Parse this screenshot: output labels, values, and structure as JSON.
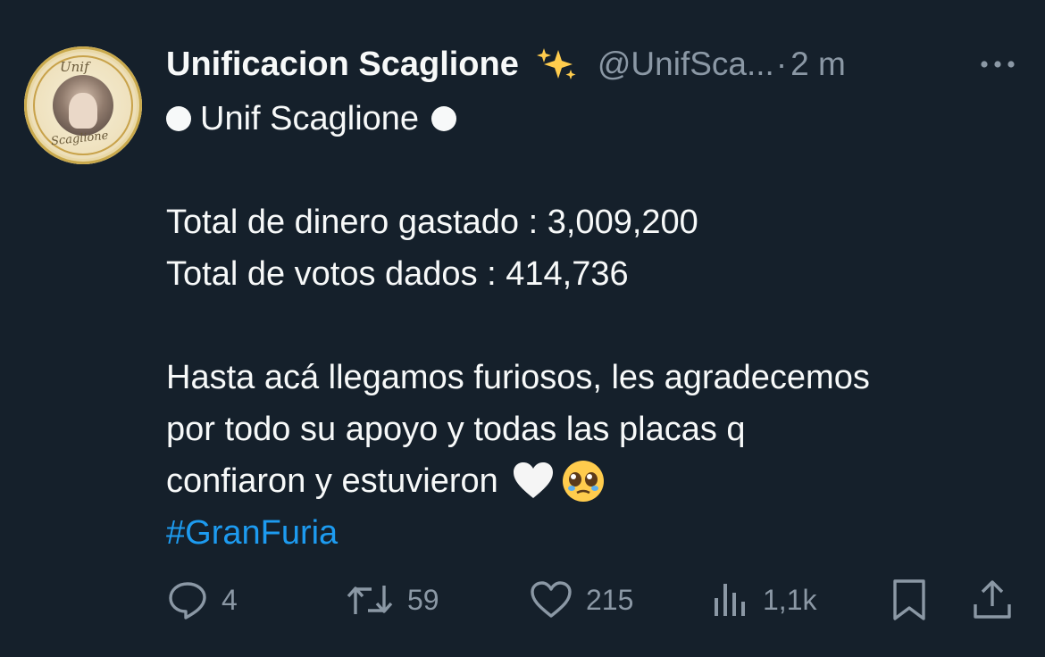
{
  "author": {
    "display_name": "Unificacion Scaglione",
    "name_emoji": "sparkles-icon",
    "handle": "@UnifSca...",
    "separator": "·",
    "time": "2 m",
    "avatar_text_top": "Unif",
    "avatar_text_bottom": "Scaglione"
  },
  "tweet": {
    "line1": "Unif Scaglione",
    "line2": "Total de dinero gastado : 3,009,200",
    "line3": "Total de votos dados : 414,736",
    "line4": "Hasta acá llegamos furiosos, les agradecemos",
    "line5": "por todo su apoyo y todas las placas q",
    "line6": "confiaron y estuvieron",
    "hashtag": "#GranFuria"
  },
  "actions": {
    "replies": "4",
    "retweets": "59",
    "likes": "215",
    "views": "1,1k"
  },
  "colors": {
    "background": "#15202b",
    "text": "#f7f9f9",
    "muted": "#8b98a5",
    "link": "#1d9bf0"
  }
}
